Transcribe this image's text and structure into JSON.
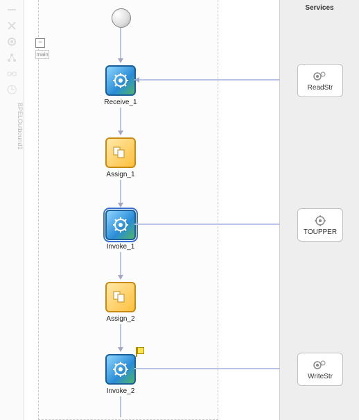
{
  "services_panel": {
    "title": "Services"
  },
  "toolbar": {
    "vertical_label": "BPELOutbound1"
  },
  "scope": {
    "collapse_symbol": "−",
    "scope_label": "main"
  },
  "activities": {
    "receive": {
      "label": "Receive_1"
    },
    "assign1": {
      "label": "Assign_1"
    },
    "invoke1": {
      "label": "Invoke_1"
    },
    "assign2": {
      "label": "Assign_2"
    },
    "invoke2": {
      "label": "Invoke_2"
    }
  },
  "services": {
    "readstr": {
      "label": "ReadStr"
    },
    "toupper": {
      "label": "TOUPPER"
    },
    "writestr": {
      "label": "WriteStr"
    }
  }
}
